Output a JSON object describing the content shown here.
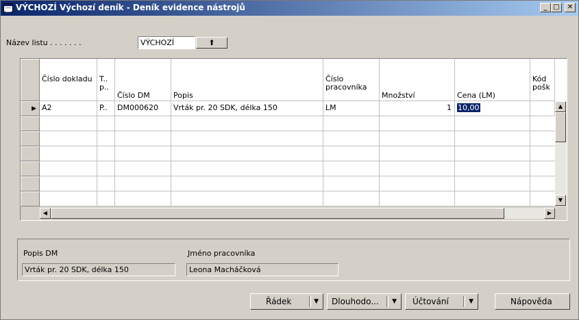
{
  "window": {
    "title": "VÝCHOZÍ Výchozí deník - Deník evidence nástrojů",
    "controls": {
      "minimize": "_",
      "maximize": "□",
      "close": "✕"
    }
  },
  "sheet": {
    "label": "Název listu . . . . . . .",
    "value": "VÝCHOZÍ",
    "lookup_symbol": "⬆"
  },
  "grid": {
    "columns": [
      {
        "key": "doc",
        "label": "Číslo dokladu"
      },
      {
        "key": "type",
        "label": "T.. p.."
      },
      {
        "key": "dm",
        "label": "Číslo DM"
      },
      {
        "key": "desc",
        "label": "Popis"
      },
      {
        "key": "worker",
        "label": "Číslo pracovníka"
      },
      {
        "key": "qty",
        "label": "Množství"
      },
      {
        "key": "price",
        "label": "Cena (LM)"
      },
      {
        "key": "code",
        "label": "Kód pošk"
      }
    ],
    "rows": [
      {
        "doc": "A2",
        "type": "P..",
        "dm": "DM000620",
        "desc": "Vrták pr. 20 SDK, délka 150",
        "worker": "LM",
        "qty": "1",
        "price": "10,00",
        "code": ""
      }
    ],
    "current_row_marker": "▶"
  },
  "details": {
    "desc_label": "Popis DM",
    "desc_value": "Vrták pr. 20 SDK, délka 150",
    "worker_label": "Jméno pracovníka",
    "worker_value": "Leona Macháčková"
  },
  "buttons": [
    {
      "label": "Řádek",
      "dropdown": true
    },
    {
      "label": "Dlouhodo...",
      "dropdown": true
    },
    {
      "label": "Účtování",
      "dropdown": true
    },
    {
      "label": "Nápověda",
      "dropdown": false
    }
  ],
  "colors": {
    "titlebar_start": "#0a246a",
    "titlebar_end": "#a6caf0",
    "selection": "#0a246a",
    "face": "#d4d0c8"
  }
}
